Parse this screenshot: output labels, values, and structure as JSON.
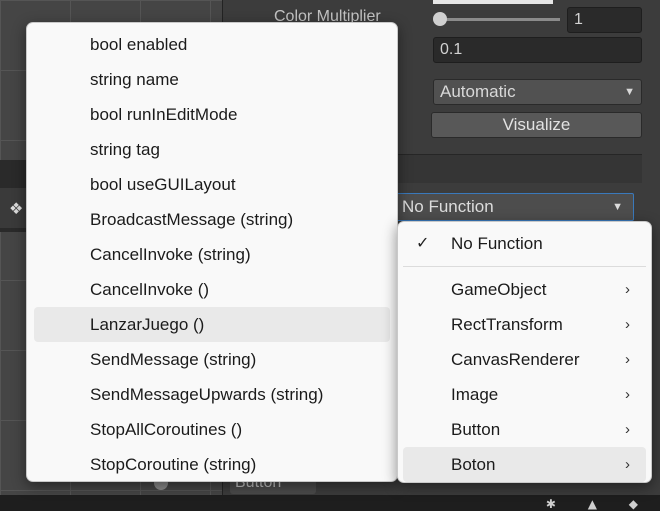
{
  "inspector": {
    "color_multiplier_label": "Color Multiplier",
    "color_multiplier_value": "1",
    "fade_duration_value": "0.1",
    "navigation_value": "Automatic",
    "visualize_label": "Visualize",
    "function_selected": "No Function",
    "bottom_label": "Button"
  },
  "function_menu": {
    "items": [
      "bool enabled",
      "string name",
      "bool runInEditMode",
      "string tag",
      "bool useGUILayout",
      "BroadcastMessage (string)",
      "CancelInvoke (string)",
      "CancelInvoke ()",
      "LanzarJuego ()",
      "SendMessage (string)",
      "SendMessageUpwards (string)",
      "StopAllCoroutines ()",
      "StopCoroutine (string)"
    ],
    "highlighted": "LanzarJuego ()"
  },
  "component_menu": {
    "no_function": "No Function",
    "items": [
      "GameObject",
      "RectTransform",
      "CanvasRenderer",
      "Image",
      "Button",
      "Boton"
    ],
    "highlighted": "Boton"
  },
  "icons": {
    "check": "✓",
    "submenu_arrow": "›",
    "caret": "▼"
  }
}
